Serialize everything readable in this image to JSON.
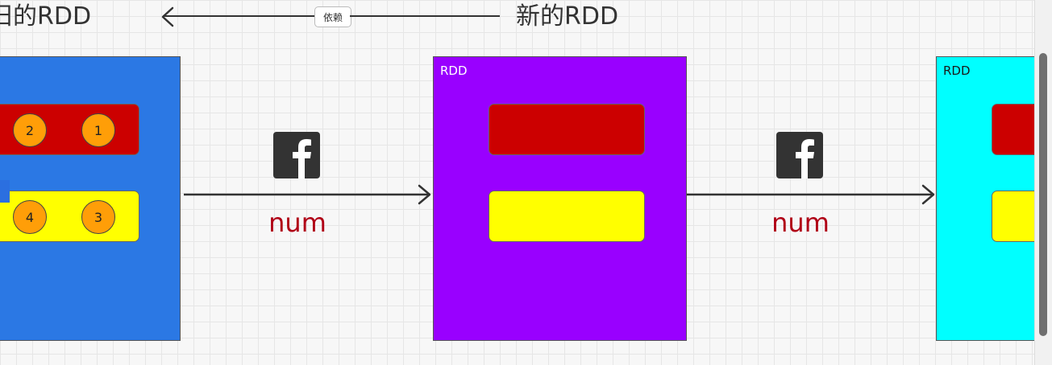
{
  "header": {
    "old_rdd_label": "旧的RDD",
    "new_rdd_label": "新的RDD",
    "dependency_tag": "依赖"
  },
  "rdds": [
    {
      "label": "",
      "color": "#2b78e4",
      "partitions": [
        {
          "color": "#cc0000",
          "elements": [
            "2",
            "1"
          ]
        },
        {
          "color": "#ffff00",
          "elements": [
            "4",
            "3"
          ]
        }
      ]
    },
    {
      "label": "RDD",
      "color": "#9900ff",
      "partitions": [
        {
          "color": "#cc0000",
          "elements": []
        },
        {
          "color": "#ffff00",
          "elements": []
        }
      ]
    },
    {
      "label": "RDD",
      "color": "#00ffff",
      "partitions": [
        {
          "color": "#cc0000",
          "elements": []
        },
        {
          "color": "#ffff00",
          "elements": []
        }
      ]
    }
  ],
  "transforms": [
    {
      "icon": "function-icon",
      "label": "num"
    },
    {
      "icon": "function-icon",
      "label": "num"
    }
  ],
  "colors": {
    "arrow": "#333333",
    "function_label": "#b00016",
    "element_ball": "#ff9e08"
  }
}
